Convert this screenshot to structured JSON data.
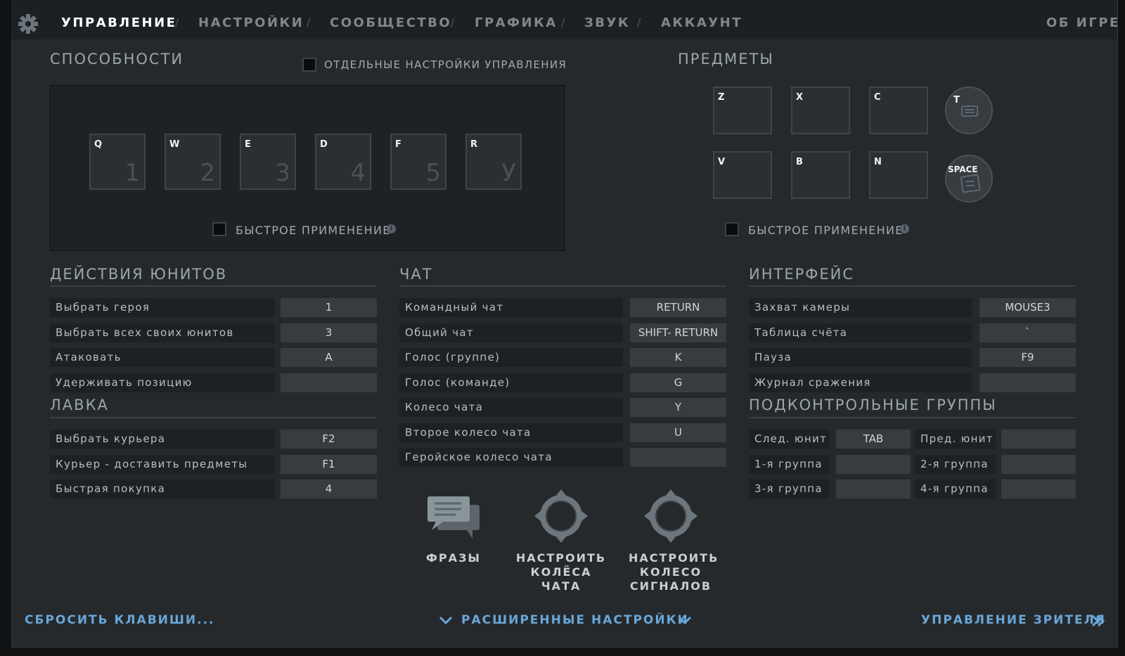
{
  "nav": {
    "tabs": [
      "УПРАВЛЕНИЕ",
      "НАСТРОЙКИ",
      "СООБЩЕСТВО",
      "ГРАФИКА",
      "ЗВУК",
      "АККАУНТ"
    ],
    "separator": "/",
    "about": "ОБ ИГРЕ"
  },
  "abilities": {
    "title": "СПОСОБНОСТИ",
    "separate_controls": "ОТДЕЛЬНЫЕ НАСТРОЙКИ УПРАВЛЕНИЯ",
    "slots": [
      {
        "key": "Q",
        "num": "1"
      },
      {
        "key": "W",
        "num": "2"
      },
      {
        "key": "E",
        "num": "3"
      },
      {
        "key": "D",
        "num": "4"
      },
      {
        "key": "F",
        "num": "5"
      },
      {
        "key": "R",
        "num": "У"
      }
    ],
    "quick_cast": "БЫСТРОЕ ПРИМЕНЕНИЕ"
  },
  "items": {
    "title": "ПРЕДМЕТЫ",
    "slots": [
      "Z",
      "X",
      "C",
      "V",
      "B",
      "N"
    ],
    "tp_key": "T",
    "neutral_key": "SPACE",
    "quick_cast": "БЫСТРОЕ ПРИМЕНЕНИЕ"
  },
  "unit_actions": {
    "title": "ДЕЙСТВИЯ ЮНИТОВ",
    "rows": [
      {
        "label": "Выбрать героя",
        "key": "1"
      },
      {
        "label": "Выбрать всех своих юнитов",
        "key": "3"
      },
      {
        "label": "Атаковать",
        "key": "A"
      },
      {
        "label": "Удерживать позицию",
        "key": ""
      }
    ]
  },
  "shop": {
    "title": "ЛАВКА",
    "rows": [
      {
        "label": "Выбрать курьера",
        "key": "F2"
      },
      {
        "label": "Курьер - доставить предметы",
        "key": "F1"
      },
      {
        "label": "Быстрая покупка",
        "key": "4"
      }
    ]
  },
  "chat": {
    "title": "ЧАТ",
    "rows": [
      {
        "label": "Командный чат",
        "key": "RETURN"
      },
      {
        "label": "Общий чат",
        "key": "SHIFT- RETURN"
      },
      {
        "label": "Голос (группе)",
        "key": "K"
      },
      {
        "label": "Голос (команде)",
        "key": "G"
      },
      {
        "label": "Колесо чата",
        "key": "Y"
      },
      {
        "label": "Второе колесо чата",
        "key": "U"
      },
      {
        "label": "Геройское колесо чата",
        "key": ""
      }
    ],
    "buttons": {
      "phrases": "ФРАЗЫ",
      "chat_wheel": "НАСТРОИТЬ КОЛЁСА ЧАТА",
      "ping_wheel": "НАСТРОИТЬ КОЛЕСО СИГНАЛОВ"
    }
  },
  "interface": {
    "title": "ИНТЕРФЕЙС",
    "rows": [
      {
        "label": "Захват камеры",
        "key": "MOUSE3"
      },
      {
        "label": "Таблица счёта",
        "key": "`"
      },
      {
        "label": "Пауза",
        "key": "F9"
      },
      {
        "label": "Журнал сражения",
        "key": ""
      }
    ]
  },
  "control_groups": {
    "title": "ПОДКОНТРОЛЬНЫЕ ГРУППЫ",
    "rows": [
      {
        "label1": "След. юнит",
        "key1": "TAB",
        "label2": "Пред. юнит",
        "key2": ""
      },
      {
        "label1": "1-я группа",
        "key1": "",
        "label2": "2-я группа",
        "key2": ""
      },
      {
        "label1": "3-я группа",
        "key1": "",
        "label2": "4-я группа",
        "key2": ""
      }
    ]
  },
  "footer": {
    "reset": "СБРОСИТЬ КЛАВИШИ...",
    "advanced": "РАСШИРЕННЫЕ НАСТРОЙКИ",
    "spectator": "УПРАВЛЕНИЕ ЗРИТЕЛЯ"
  },
  "colors": {
    "panel_bg": "#25292c",
    "key_bg": "#363c40",
    "link": "#6aa6d8"
  },
  "icons": [
    "gear-icon",
    "info-icon",
    "chat-bubbles-icon",
    "chat-wheel-icon",
    "ping-wheel-icon",
    "chevron-down-icon",
    "double-chevron-right-icon",
    "teleport-scroll-icon",
    "neutral-item-icon"
  ]
}
